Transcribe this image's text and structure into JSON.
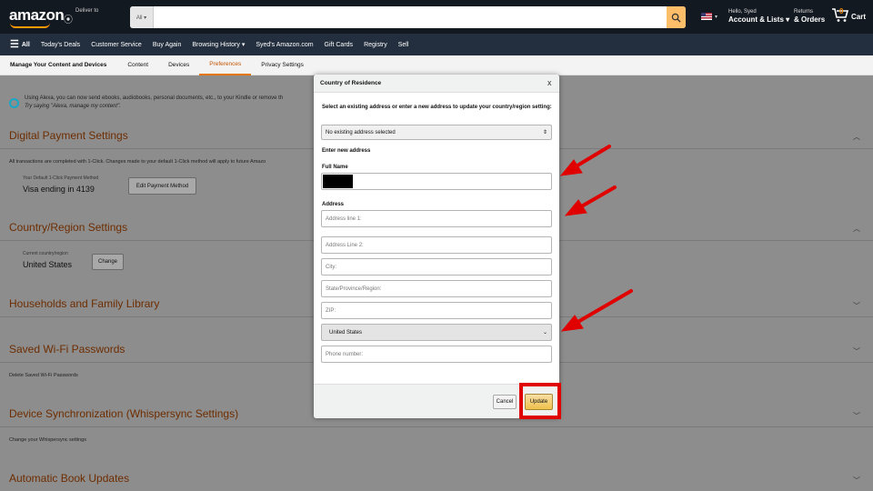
{
  "header": {
    "logo": "amazon",
    "deliver_to": "Deliver to",
    "search_category": "All ▾",
    "search_placeholder": "",
    "account_greeting": "Hello, Syed",
    "account_label": "Account & Lists ▾",
    "returns_label": "Returns",
    "orders_label": "& Orders",
    "cart_count": "0",
    "cart_label": "Cart"
  },
  "nav": {
    "all_label": "All",
    "items": [
      "Today's Deals",
      "Customer Service",
      "Buy Again",
      "Browsing History ▾",
      "Syed's Amazon.com",
      "Gift Cards",
      "Registry",
      "Sell"
    ]
  },
  "subnav": {
    "title": "Manage Your Content and Devices",
    "tabs": [
      "Content",
      "Devices",
      "Preferences",
      "Privacy Settings"
    ],
    "active_tab": "Preferences"
  },
  "page": {
    "alexa_line1": "Using Alexa, you can now send ebooks, audiobooks, personal documents, etc., to your Kindle or remove th",
    "alexa_line2": "Try saying \"Alexa, manage my content\".",
    "digital_payment": {
      "title": "Digital Payment Settings",
      "desc": "All transactions are completed with 1-Click. Changes made to your default 1-Click method will apply to future Amazo",
      "method_label": "Your Default 1-Click Payment Method",
      "method_value": "Visa ending in 4139",
      "edit_button": "Edit Payment Method"
    },
    "country": {
      "title": "Country/Region Settings",
      "current_label": "Current country/region",
      "current_value": "United States",
      "change_button": "Change"
    },
    "households": {
      "title": "Households and Family Library"
    },
    "wifi": {
      "title": "Saved Wi-Fi Passwords",
      "desc": "Delete Saved Wi-Fi Passwords"
    },
    "sync": {
      "title": "Device Synchronization (Whispersync Settings)",
      "desc": "Change your Whispersync settings"
    },
    "book_updates": {
      "title": "Automatic Book Updates"
    }
  },
  "modal": {
    "title": "Country of Residence",
    "close": "x",
    "instructions": "Select an existing address or enter a new address to update your country/region setting:",
    "existing_select": "No existing address selected",
    "new_address_heading": "Enter new address",
    "full_name_label": "Full Name",
    "address_label": "Address",
    "address1_placeholder": "Address line 1:",
    "address2_placeholder": "Address Line 2:",
    "city_placeholder": "City:",
    "state_placeholder": "State/Province/Region:",
    "zip_placeholder": "ZIP:",
    "country_select": "United States",
    "phone_placeholder": "Phone number:",
    "cancel_button": "Cancel",
    "update_button": "Update"
  },
  "annotation_color": "#e00000"
}
